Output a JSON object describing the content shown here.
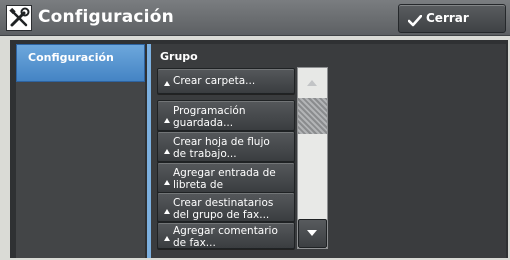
{
  "header": {
    "title": "Configuración",
    "app_icon": "tools-icon",
    "close_label": "Cerrar",
    "close_icon": "checkmark-icon"
  },
  "sidebar": {
    "items": [
      {
        "label": "Configuración",
        "selected": true
      }
    ]
  },
  "main": {
    "section_label": "Grupo",
    "items": [
      {
        "label": "Crear carpeta..."
      },
      {
        "label": "Programación\nguardada..."
      },
      {
        "label": "Crear hoja de flujo\nde trabajo..."
      },
      {
        "label": "Agregar entrada de\nlibreta de direcciones..."
      },
      {
        "label": "Crear destinatarios\ndel grupo de fax..."
      },
      {
        "label": "Agregar comentario\nde fax..."
      }
    ]
  },
  "scrollbar": {
    "up_icon": "arrow-up-icon",
    "down_icon": "arrow-down-icon",
    "up_enabled": false,
    "down_enabled": true
  },
  "colors": {
    "accent": "#4a8ac9",
    "panel": "#3a3c3e",
    "header": "#6b6e71"
  }
}
